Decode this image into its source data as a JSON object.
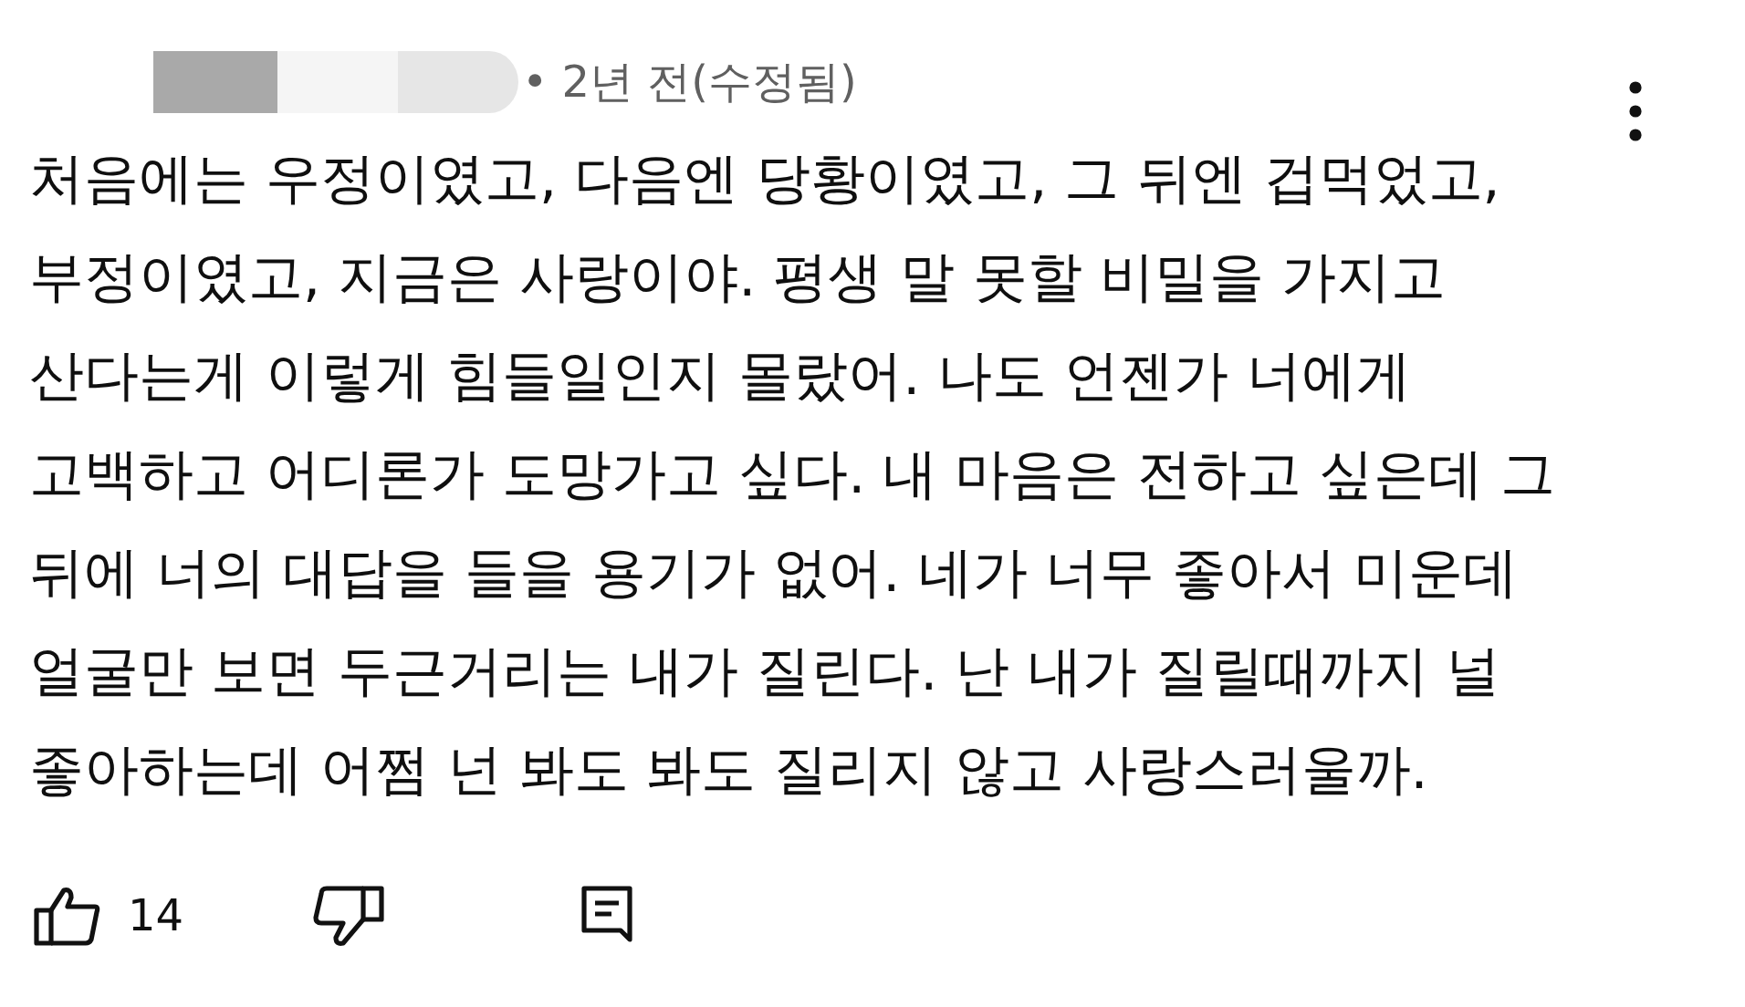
{
  "comment": {
    "time": "• 2년 전(수정됨)",
    "text": "처음에는 우정이였고, 다음엔 당황이였고, 그 뒤엔 겁먹었고,\n부정이였고, 지금은 사랑이야. 평생 말 못할 비밀을 가지고\n산다는게 이렇게 힘들일인지 몰랐어. 나도 언젠가 너에게\n고백하고 어디론가 도망가고 싶다. 내 마음은 전하고 싶은데 그\n뒤에 너의 대답을 들을 용기가 없어. 네가 너무 좋아서 미운데\n얼굴만 보면 두근거리는 내가 질린다. 난 내가 질릴때까지 널\n좋아하는데 어쩜 넌 봐도 봐도 질리지 않고 사랑스러울까.",
    "like_count": "14"
  }
}
